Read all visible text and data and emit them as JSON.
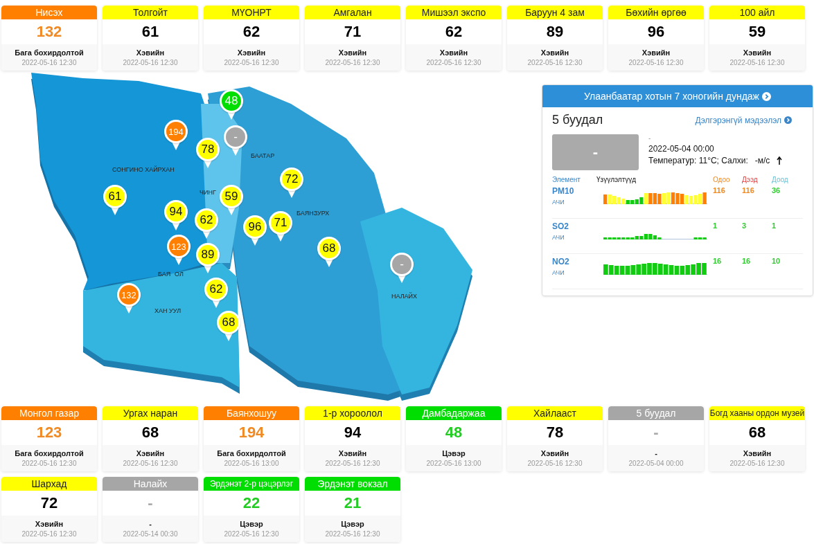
{
  "top_cards": [
    {
      "name": "Нисэх",
      "value": "132",
      "status": "Бага бохирдолтой",
      "time": "2022-05-16 12:30",
      "color": "#ff7f00"
    },
    {
      "name": "Толгойт",
      "value": "61",
      "status": "Хэвийн",
      "time": "2022-05-16 12:30",
      "color": "#ffff00"
    },
    {
      "name": "МҮОНРТ",
      "value": "62",
      "status": "Хэвийн",
      "time": "2022-05-16 12:30",
      "color": "#ffff00"
    },
    {
      "name": "Амгалан",
      "value": "71",
      "status": "Хэвийн",
      "time": "2022-05-16 12:30",
      "color": "#ffff00"
    },
    {
      "name": "Мишээл экспо",
      "value": "62",
      "status": "Хэвийн",
      "time": "2022-05-16 12:30",
      "color": "#ffff00"
    },
    {
      "name": "Баруун 4 зам",
      "value": "89",
      "status": "Хэвийн",
      "time": "2022-05-16 12:30",
      "color": "#ffff00"
    },
    {
      "name": "Бөхийн өргөө",
      "value": "96",
      "status": "Хэвийн",
      "time": "2022-05-16 12:30",
      "color": "#ffff00"
    },
    {
      "name": "100 айл",
      "value": "59",
      "status": "Хэвийн",
      "time": "2022-05-16 12:30",
      "color": "#ffff00"
    }
  ],
  "map": {
    "pins": [
      {
        "value": "48",
        "color": "#00dd00"
      },
      {
        "value": "194",
        "color": "#ff7f00"
      },
      {
        "value": "78",
        "color": "#ffff00"
      },
      {
        "value": "-",
        "color": "#a6a6a6"
      },
      {
        "value": "61",
        "color": "#ffff00"
      },
      {
        "value": "72",
        "color": "#ffff00"
      },
      {
        "value": "59",
        "color": "#ffff00"
      },
      {
        "value": "94",
        "color": "#ffff00"
      },
      {
        "value": "62",
        "color": "#ffff00"
      },
      {
        "value": "89",
        "color": "#ffff00"
      },
      {
        "value": "123",
        "color": "#ff7f00"
      },
      {
        "value": "96",
        "color": "#ffff00"
      },
      {
        "value": "71",
        "color": "#ffff00"
      },
      {
        "value": "68",
        "color": "#ffff00"
      },
      {
        "value": "-",
        "color": "#a6a6a6"
      },
      {
        "value": "62",
        "color": "#ffff00"
      },
      {
        "value": "132",
        "color": "#ff7f00"
      },
      {
        "value": "68",
        "color": "#ffff00"
      }
    ],
    "districts": [
      "СОНГИНО ХАЙРХАН",
      "БААТАР",
      "ЧИНГ",
      "БАЯНЗУРХ",
      "БАЯ",
      "ОЛ",
      "ХАН УУЛ",
      "НАЛАЙХ"
    ]
  },
  "panel": {
    "title": "Улаанбаатар хотын 7 хоногийн дундаж",
    "station": "5 буудал",
    "details_link": "Дэлгэрэнгүй мэдээлэл",
    "aqi": "-",
    "status": "-",
    "time": "2022-05-04 00:00",
    "weather": "Температур: 11°C; Салхи:   -м/с",
    "columns": [
      "Элемент",
      "Үзүүлэлтүүд",
      "Одоо",
      "Дээд",
      "Доод"
    ],
    "rows": [
      {
        "element": "PM10",
        "unit": "АЧИ",
        "values": [
          {
            "text": "116",
            "color": "#f08a24"
          },
          {
            "text": "116",
            "color": "#f08a24"
          },
          {
            "text": "36",
            "color": "#33cc33"
          }
        ]
      },
      {
        "element": "SO2",
        "unit": "АЧИ",
        "values": [
          {
            "text": "1",
            "color": "#33cc33"
          },
          {
            "text": "3",
            "color": "#33cc33"
          },
          {
            "text": "1",
            "color": "#33cc33"
          }
        ]
      },
      {
        "element": "NO2",
        "unit": "АЧИ",
        "values": [
          {
            "text": "16",
            "color": "#33cc33"
          },
          {
            "text": "16",
            "color": "#33cc33"
          },
          {
            "text": "10",
            "color": "#33cc33"
          }
        ]
      }
    ]
  },
  "bottom_cards": [
    {
      "name": "Монгол газар",
      "value": "123",
      "status": "Бага бохирдолтой",
      "time": "2022-05-16 12:30",
      "color": "#ff7f00"
    },
    {
      "name": "Ургах наран",
      "value": "68",
      "status": "Хэвийн",
      "time": "2022-05-16 12:30",
      "color": "#ffff00"
    },
    {
      "name": "Баянхошуу",
      "value": "194",
      "status": "Бага бохирдолтой",
      "time": "2022-05-16 13:00",
      "color": "#ff7f00"
    },
    {
      "name": "1-р хороолол",
      "value": "94",
      "status": "Хэвийн",
      "time": "2022-05-16 12:30",
      "color": "#ffff00"
    },
    {
      "name": "Дамбадаржаа",
      "value": "48",
      "status": "Цэвэр",
      "time": "2022-05-16 13:00",
      "color": "#00dd00"
    },
    {
      "name": "Хайлааст",
      "value": "78",
      "status": "Хэвийн",
      "time": "2022-05-16 12:30",
      "color": "#ffff00"
    },
    {
      "name": "5 буудал",
      "value": "-",
      "status": "-",
      "time": "2022-05-04 00:00",
      "color": "#a6a6a6"
    },
    {
      "name": "Богд хааны ордон музей",
      "value": "68",
      "status": "Хэвийн",
      "time": "2022-05-16 12:30",
      "color": "#ffff00"
    },
    {
      "name": "Шархад",
      "value": "72",
      "status": "Хэвийн",
      "time": "2022-05-16 12:30",
      "color": "#ffff00"
    },
    {
      "name": "Налайх",
      "value": "-",
      "status": "-",
      "time": "2022-05-14 00:30",
      "color": "#a6a6a6"
    },
    {
      "name": "Эрдэнэт 2-р цэцэрлэг",
      "value": "22",
      "status": "Цэвэр",
      "time": "2022-05-16 12:30",
      "color": "#00dd00"
    },
    {
      "name": "Эрдэнэт вокзал",
      "value": "21",
      "status": "Цэвэр",
      "time": "2022-05-16 12:30",
      "color": "#00dd00"
    }
  ]
}
